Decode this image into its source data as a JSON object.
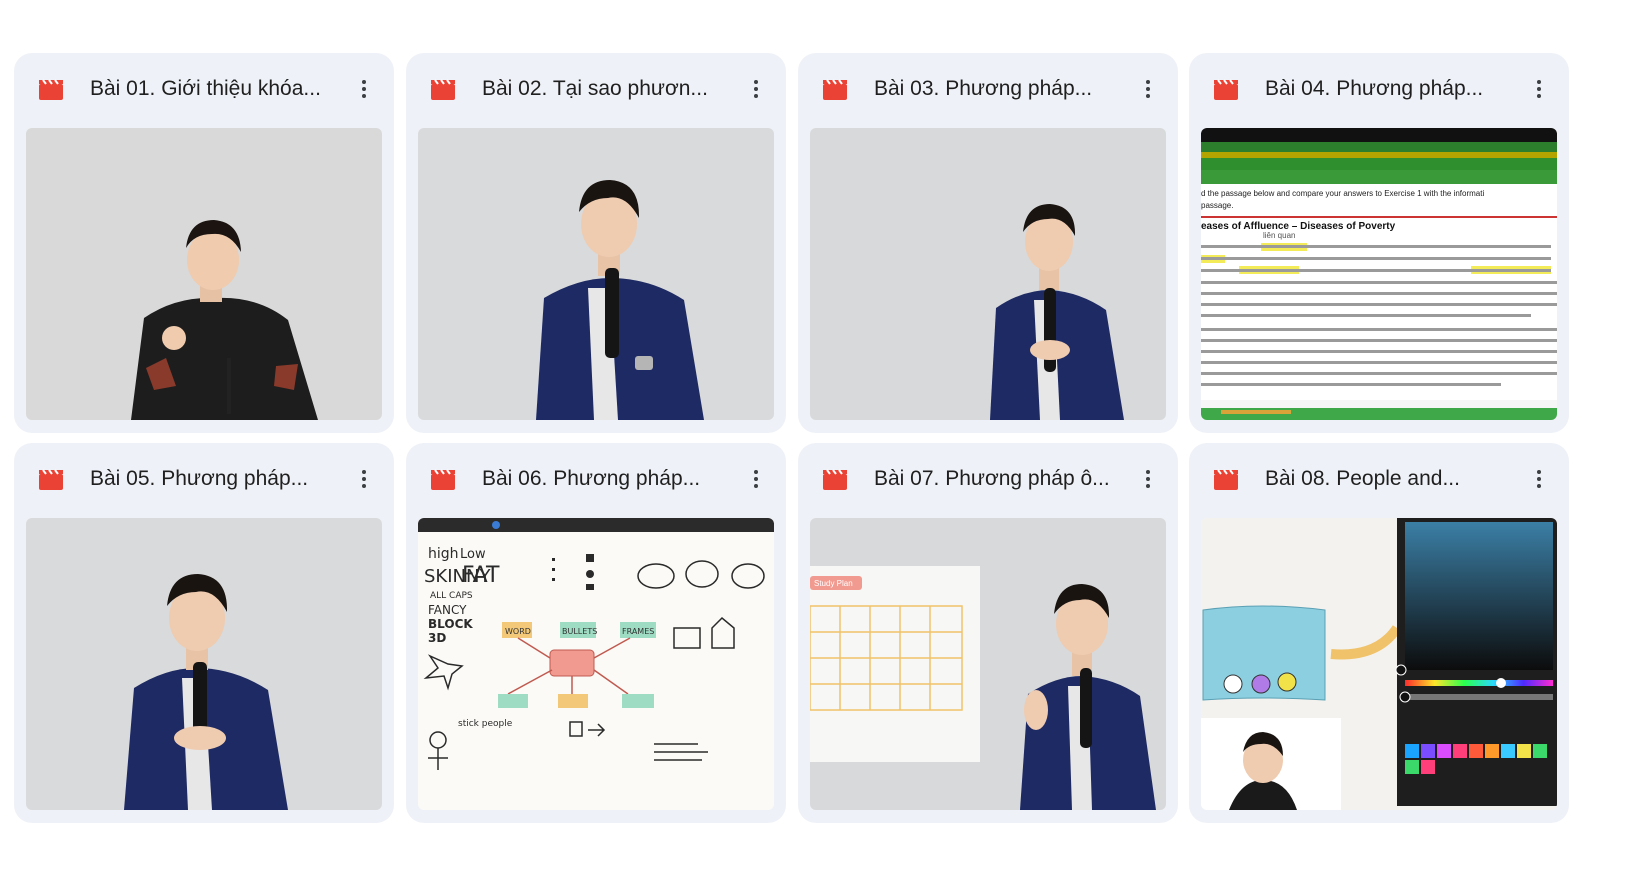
{
  "files": [
    {
      "title": "Bài 01. Giới thiệu khóa...",
      "icon": "video-file-icon",
      "thumbnail": "presenter-talking"
    },
    {
      "title": "Bài 02. Tại sao phươn...",
      "icon": "video-file-icon",
      "thumbnail": "presenter-talking"
    },
    {
      "title": "Bài 03. Phương pháp...",
      "icon": "video-file-icon",
      "thumbnail": "presenter-talking"
    },
    {
      "title": "Bài 04. Phương pháp...",
      "icon": "video-file-icon",
      "thumbnail": "reading-passage"
    },
    {
      "title": "Bài 05. Phương pháp...",
      "icon": "video-file-icon",
      "thumbnail": "presenter-talking"
    },
    {
      "title": "Bài 06. Phương pháp...",
      "icon": "video-file-icon",
      "thumbnail": "whiteboard-sketch"
    },
    {
      "title": "Bài 07. Phương pháp ô...",
      "icon": "video-file-icon",
      "thumbnail": "presenter-with-calendar"
    },
    {
      "title": "Bài 08. People and...",
      "icon": "video-file-icon",
      "thumbnail": "drawing-app-with-presenter"
    }
  ],
  "thumb_text": {
    "passage_line1": "d the passage below and compare your answers to Exercise 1 with the informati",
    "passage_line2": "passage.",
    "passage_heading": "eases of Affluence – Diseases of Poverty",
    "passage_note": "liên quan",
    "board_high": "high",
    "board_low": "Low",
    "board_skinny": "SKINNY",
    "board_fat": "FAT",
    "board_allcaps": "ALL CAPS",
    "board_fancy": "FANCY",
    "board_block": "BLOCK",
    "board_3d": "3D",
    "board_word": "WORD",
    "board_bullets": "BULLETS",
    "board_frames": "FRAMES",
    "board_people": "stick people",
    "calendar_tag": "Study Plan"
  },
  "colors": {
    "card_bg": "#eef1f7",
    "video_icon": "#ea4335",
    "title_text": "#1f1f1f"
  }
}
